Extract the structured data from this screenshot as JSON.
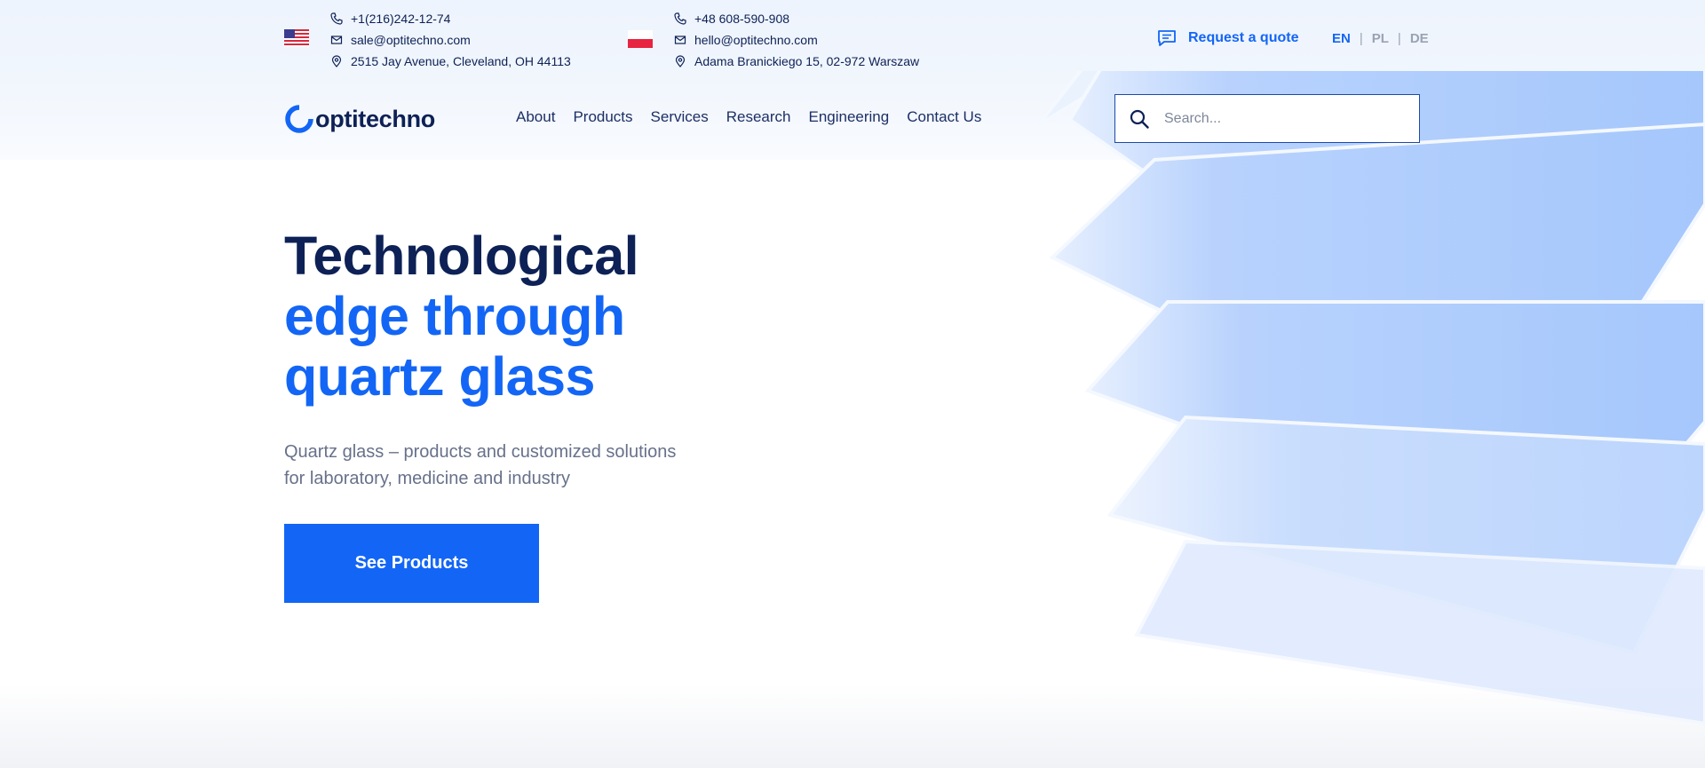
{
  "contacts": {
    "us": {
      "flag": "us-flag",
      "phone": "+1(216)242-12-74",
      "email": "sale@optitechno.com",
      "address": "2515 Jay Avenue, Cleveland, OH 44113"
    },
    "pl": {
      "flag": "poland-flag",
      "phone": "+48 608-590-908",
      "email": "hello@optitechno.com",
      "address": "Adama Branickiego 15, 02-972 Warszaw"
    }
  },
  "header": {
    "quote_label": "Request a quote",
    "languages": [
      "EN",
      "PL",
      "DE"
    ],
    "active_language": "EN",
    "separator": "|"
  },
  "logo": {
    "text": "optitechno"
  },
  "nav": {
    "items": [
      "About",
      "Products",
      "Services",
      "Research",
      "Engineering",
      "Contact Us"
    ]
  },
  "search": {
    "placeholder": "Search...",
    "value": ""
  },
  "hero": {
    "title_line1": "Technological",
    "title_line2": "edge through",
    "title_line3": "quartz glass",
    "subtitle_line1": "Quartz glass – products and customized solutions",
    "subtitle_line2": "for laboratory, medicine and industry",
    "cta_label": "See Products"
  },
  "colors": {
    "primary_blue": "#1366f5",
    "navy": "#0d2156",
    "muted_text": "#67718a",
    "top_bar_bg": "#eef4fd"
  }
}
